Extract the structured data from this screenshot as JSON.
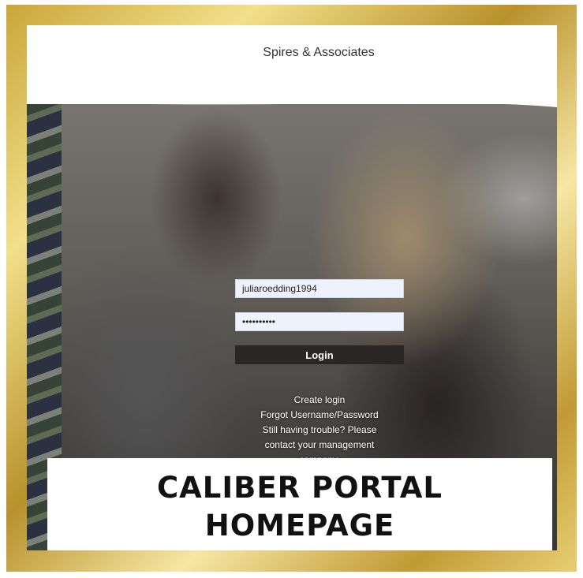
{
  "header": {
    "brand": "Spires & Associates"
  },
  "login": {
    "username_value": "juliaroedding1994",
    "password_value": "••••••••••",
    "login_label": "Login"
  },
  "links": {
    "create_login": "Create login",
    "forgot": "Forgot Username/Password",
    "trouble_line1": "Still having trouble? Please",
    "trouble_line2": "contact your management",
    "trouble_line3": "company."
  },
  "banner": {
    "line1": "CALIBER PORTAL",
    "line2": "HOMEPAGE"
  },
  "colors": {
    "frame_gold": "#c9a63a",
    "button_bg": "#2a2624",
    "field_bg": "#eef2fc"
  }
}
